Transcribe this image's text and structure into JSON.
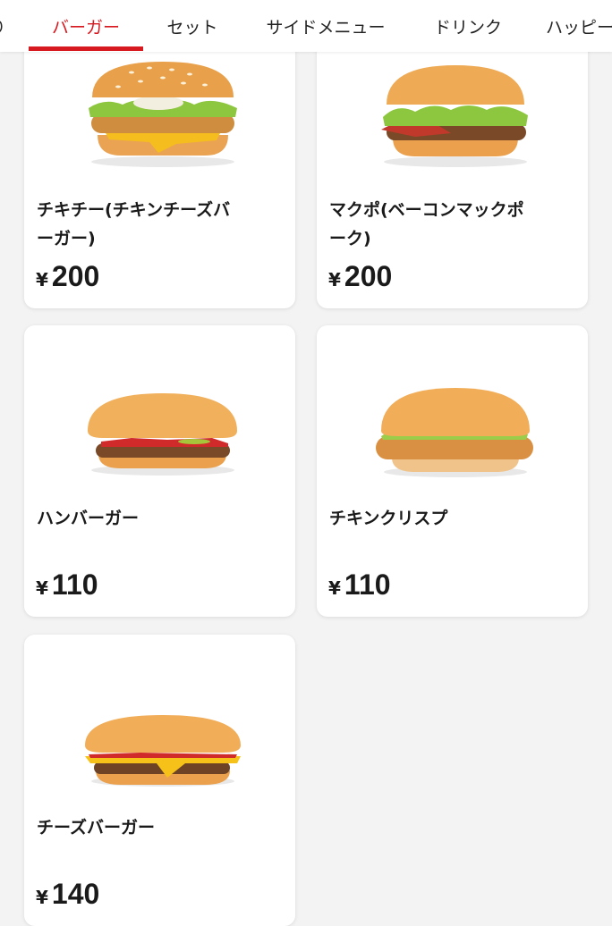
{
  "tabs": [
    {
      "label": "り"
    },
    {
      "label": "バーガー",
      "active": true
    },
    {
      "label": "セット"
    },
    {
      "label": "サイドメニュー"
    },
    {
      "label": "ドリンク"
    },
    {
      "label": "ハッピー"
    }
  ],
  "colors": {
    "accent": "#d71920",
    "background": "#f3f3f3",
    "card": "#ffffff",
    "text": "#1a1a1a"
  },
  "products": [
    {
      "name": "チキチー(チキンチーズバーガー)",
      "currency": "¥",
      "price": "200",
      "image": "chicken-cheese-burger-icon"
    },
    {
      "name": "マクポ(ベーコンマックポーク)",
      "currency": "¥",
      "price": "200",
      "image": "bacon-mac-pork-icon"
    },
    {
      "name": "ハンバーガー",
      "currency": "¥",
      "price": "110",
      "image": "hamburger-icon"
    },
    {
      "name": "チキンクリスプ",
      "currency": "¥",
      "price": "110",
      "image": "chicken-crisp-icon"
    },
    {
      "name": "チーズバーガー",
      "currency": "¥",
      "price": "140",
      "image": "cheeseburger-icon"
    }
  ]
}
